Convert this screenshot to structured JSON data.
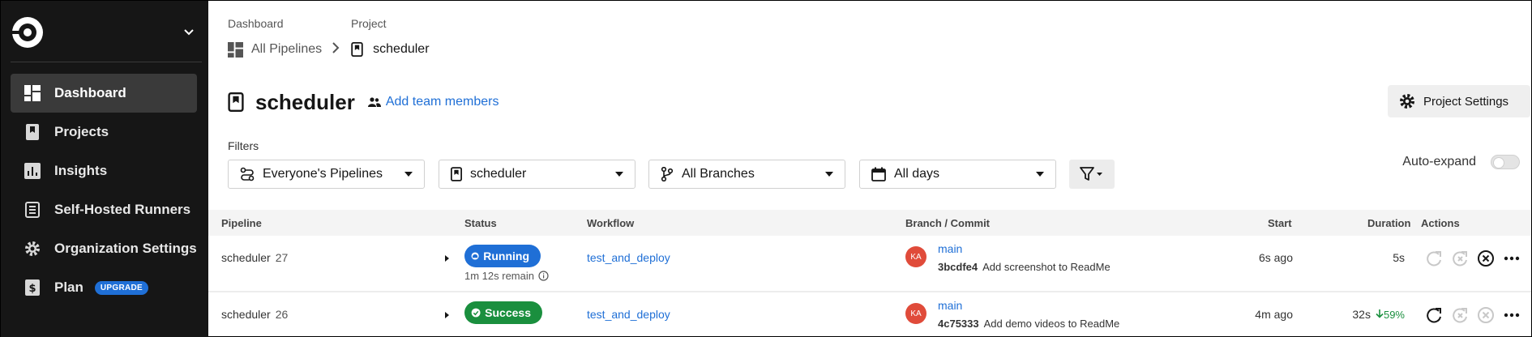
{
  "sidebar": {
    "items": [
      {
        "label": "Dashboard",
        "icon": "dashboard-icon",
        "active": true
      },
      {
        "label": "Projects",
        "icon": "bookmark-icon"
      },
      {
        "label": "Insights",
        "icon": "bar-chart-icon"
      },
      {
        "label": "Self-Hosted Runners",
        "icon": "runners-icon"
      },
      {
        "label": "Organization Settings",
        "icon": "gear-icon"
      },
      {
        "label": "Plan",
        "icon": "dollar-icon",
        "badge": "UPGRADE"
      }
    ]
  },
  "breadcrumb": {
    "label_dashboard": "Dashboard",
    "label_project": "Project",
    "all_pipelines": "All Pipelines",
    "project": "scheduler"
  },
  "header": {
    "title": "scheduler",
    "add_members": "Add team members",
    "project_settings": "Project Settings"
  },
  "filters": {
    "label": "Filters",
    "pipelines": "Everyone's Pipelines",
    "project": "scheduler",
    "branches": "All Branches",
    "days": "All days",
    "auto_expand": "Auto-expand",
    "auto_expand_on": false
  },
  "table": {
    "columns": [
      "Pipeline",
      "Status",
      "Workflow",
      "Branch / Commit",
      "Start",
      "Duration",
      "Actions"
    ],
    "rows": [
      {
        "pipeline": "scheduler",
        "number": "27",
        "status": "Running",
        "remain": "1m 12s remain",
        "workflow": "test_and_deploy",
        "avatar": "KA",
        "branch": "main",
        "hash": "3bcdfe4",
        "message": "Add screenshot to ReadMe",
        "start": "6s ago",
        "duration": "5s",
        "delta": ""
      },
      {
        "pipeline": "scheduler",
        "number": "26",
        "status": "Success",
        "remain": "",
        "workflow": "test_and_deploy",
        "avatar": "KA",
        "branch": "main",
        "hash": "4c75333",
        "message": "Add demo videos to ReadMe",
        "start": "4m ago",
        "duration": "32s",
        "delta": "59%"
      }
    ]
  },
  "colors": {
    "sidebar_bg": "#161616",
    "link": "#1f6fd6",
    "running": "#1f6fd6",
    "success": "#1a8f3e",
    "avatar": "#e04b3a"
  }
}
